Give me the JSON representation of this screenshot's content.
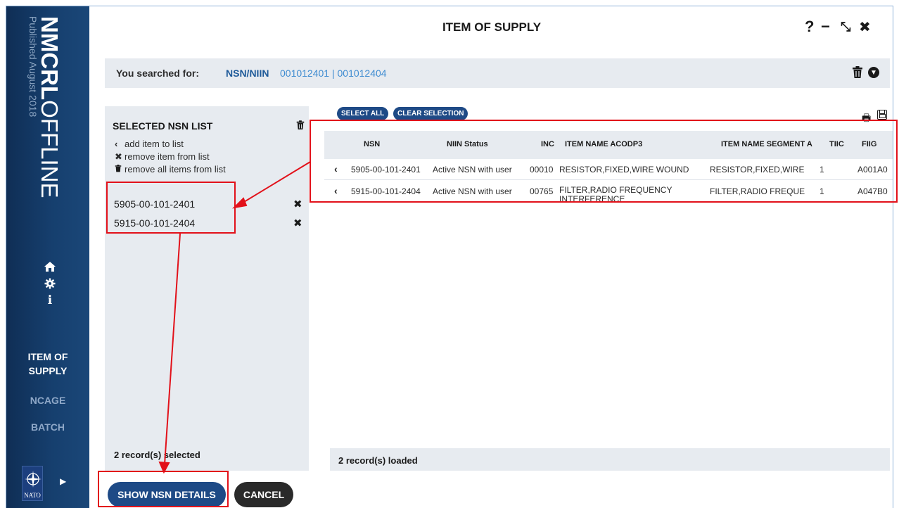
{
  "sidebar": {
    "logo_bold": "NMCRL",
    "logo_light": "OFFLINE",
    "published": "Published August 2018",
    "nav": [
      {
        "label": "ITEM OF SUPPLY",
        "line1": "ITEM OF",
        "line2": "SUPPLY",
        "active": true
      },
      {
        "label": "NCAGE",
        "active": false
      },
      {
        "label": "BATCH",
        "active": false
      }
    ],
    "nato_label": "NATO",
    "icons": [
      "home-icon",
      "gear-icon",
      "info-icon",
      "nato-logo",
      "caret-right-icon"
    ]
  },
  "window": {
    "title": "ITEM OF SUPPLY",
    "controls": {
      "help": "?",
      "minimize": "−",
      "restore": "⤡",
      "close": "✖"
    }
  },
  "search": {
    "label": "You searched for:",
    "key": "NSN/NIIN",
    "value": "001012401 | 001012404"
  },
  "selected_list": {
    "title": "SELECTED NSN LIST",
    "legend": [
      {
        "glyph": "‹",
        "text": "add item to list"
      },
      {
        "glyph": "✖",
        "text": "remove item from list"
      },
      {
        "glyph": "🗑",
        "text": "remove all items from list"
      }
    ],
    "items": [
      "5905-00-101-2401",
      "5915-00-101-2404"
    ],
    "count_text": "2 record(s) selected"
  },
  "results": {
    "select_all": "SELECT ALL",
    "clear_selection": "CLEAR SELECTION",
    "columns": [
      "NSN",
      "NIIN Status",
      "INC",
      "ITEM NAME ACODP3",
      "ITEM NAME SEGMENT A",
      "TIIC",
      "FIIG"
    ],
    "rows": [
      {
        "nsn": "5905-00-101-2401",
        "status": "Active NSN with user",
        "inc": "00010",
        "name": "RESISTOR,FIXED,WIRE WOUND",
        "segment": "RESISTOR,FIXED,WIRE",
        "tiic": "1",
        "fiig": "A001A0"
      },
      {
        "nsn": "5915-00-101-2404",
        "status": "Active NSN with user",
        "inc": "00765",
        "name": "FILTER,RADIO FREQUENCY INTERFERENCE",
        "segment": "FILTER,RADIO FREQUE",
        "tiic": "1",
        "fiig": "A047B0"
      }
    ],
    "loaded_text": "2 record(s) loaded"
  },
  "footer": {
    "show_details": "SHOW NSN DETAILS",
    "cancel": "CANCEL"
  },
  "colors": {
    "sidebar_dark": "#0f2e55",
    "accent_blue": "#1e4a86",
    "link_blue": "#3f8cd1",
    "panel_gray": "#e7ebf0",
    "annotation_red": "#e2111a"
  }
}
